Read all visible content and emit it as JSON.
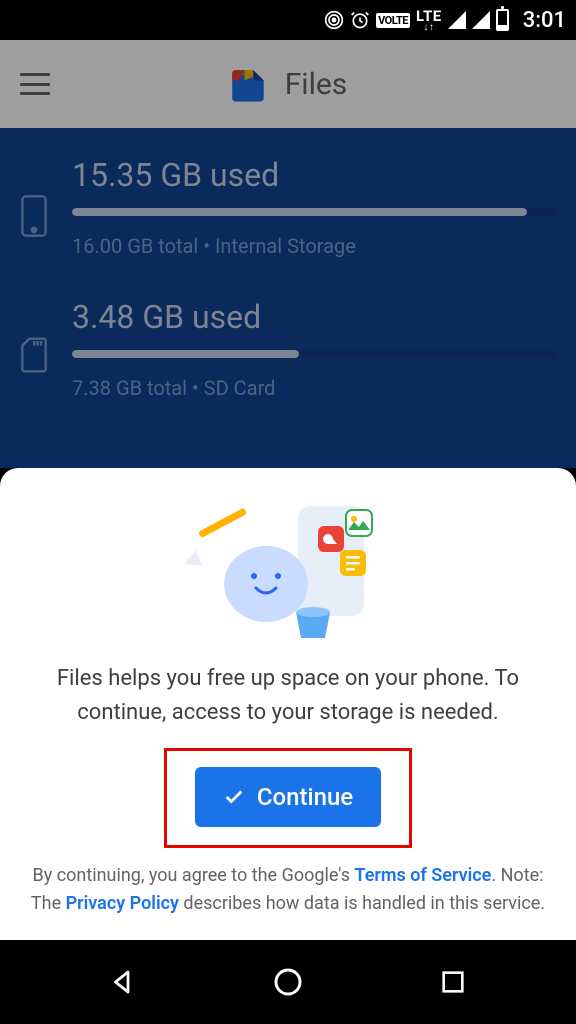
{
  "status": {
    "time": "3:01",
    "net_label": "LTE",
    "volte": "VOLTE"
  },
  "header": {
    "app_name": "Files"
  },
  "storage": {
    "internal": {
      "used_label": "15.35 GB used",
      "sub_label": "16.00 GB total • Internal Storage",
      "fill_pct": 94
    },
    "sd": {
      "used_label": "3.48 GB used",
      "sub_label": "7.38 GB total • SD Card",
      "fill_pct": 47
    }
  },
  "sheet": {
    "message": "Files helps you free up space on your phone. To continue, access to your storage is needed.",
    "continue_label": "Continue",
    "legal_pre": "By continuing, you agree to the Google's ",
    "tos": "Terms of Service",
    "legal_mid": ". Note: The ",
    "privacy": "Privacy Policy",
    "legal_post": " describes how data is handled in this service."
  }
}
